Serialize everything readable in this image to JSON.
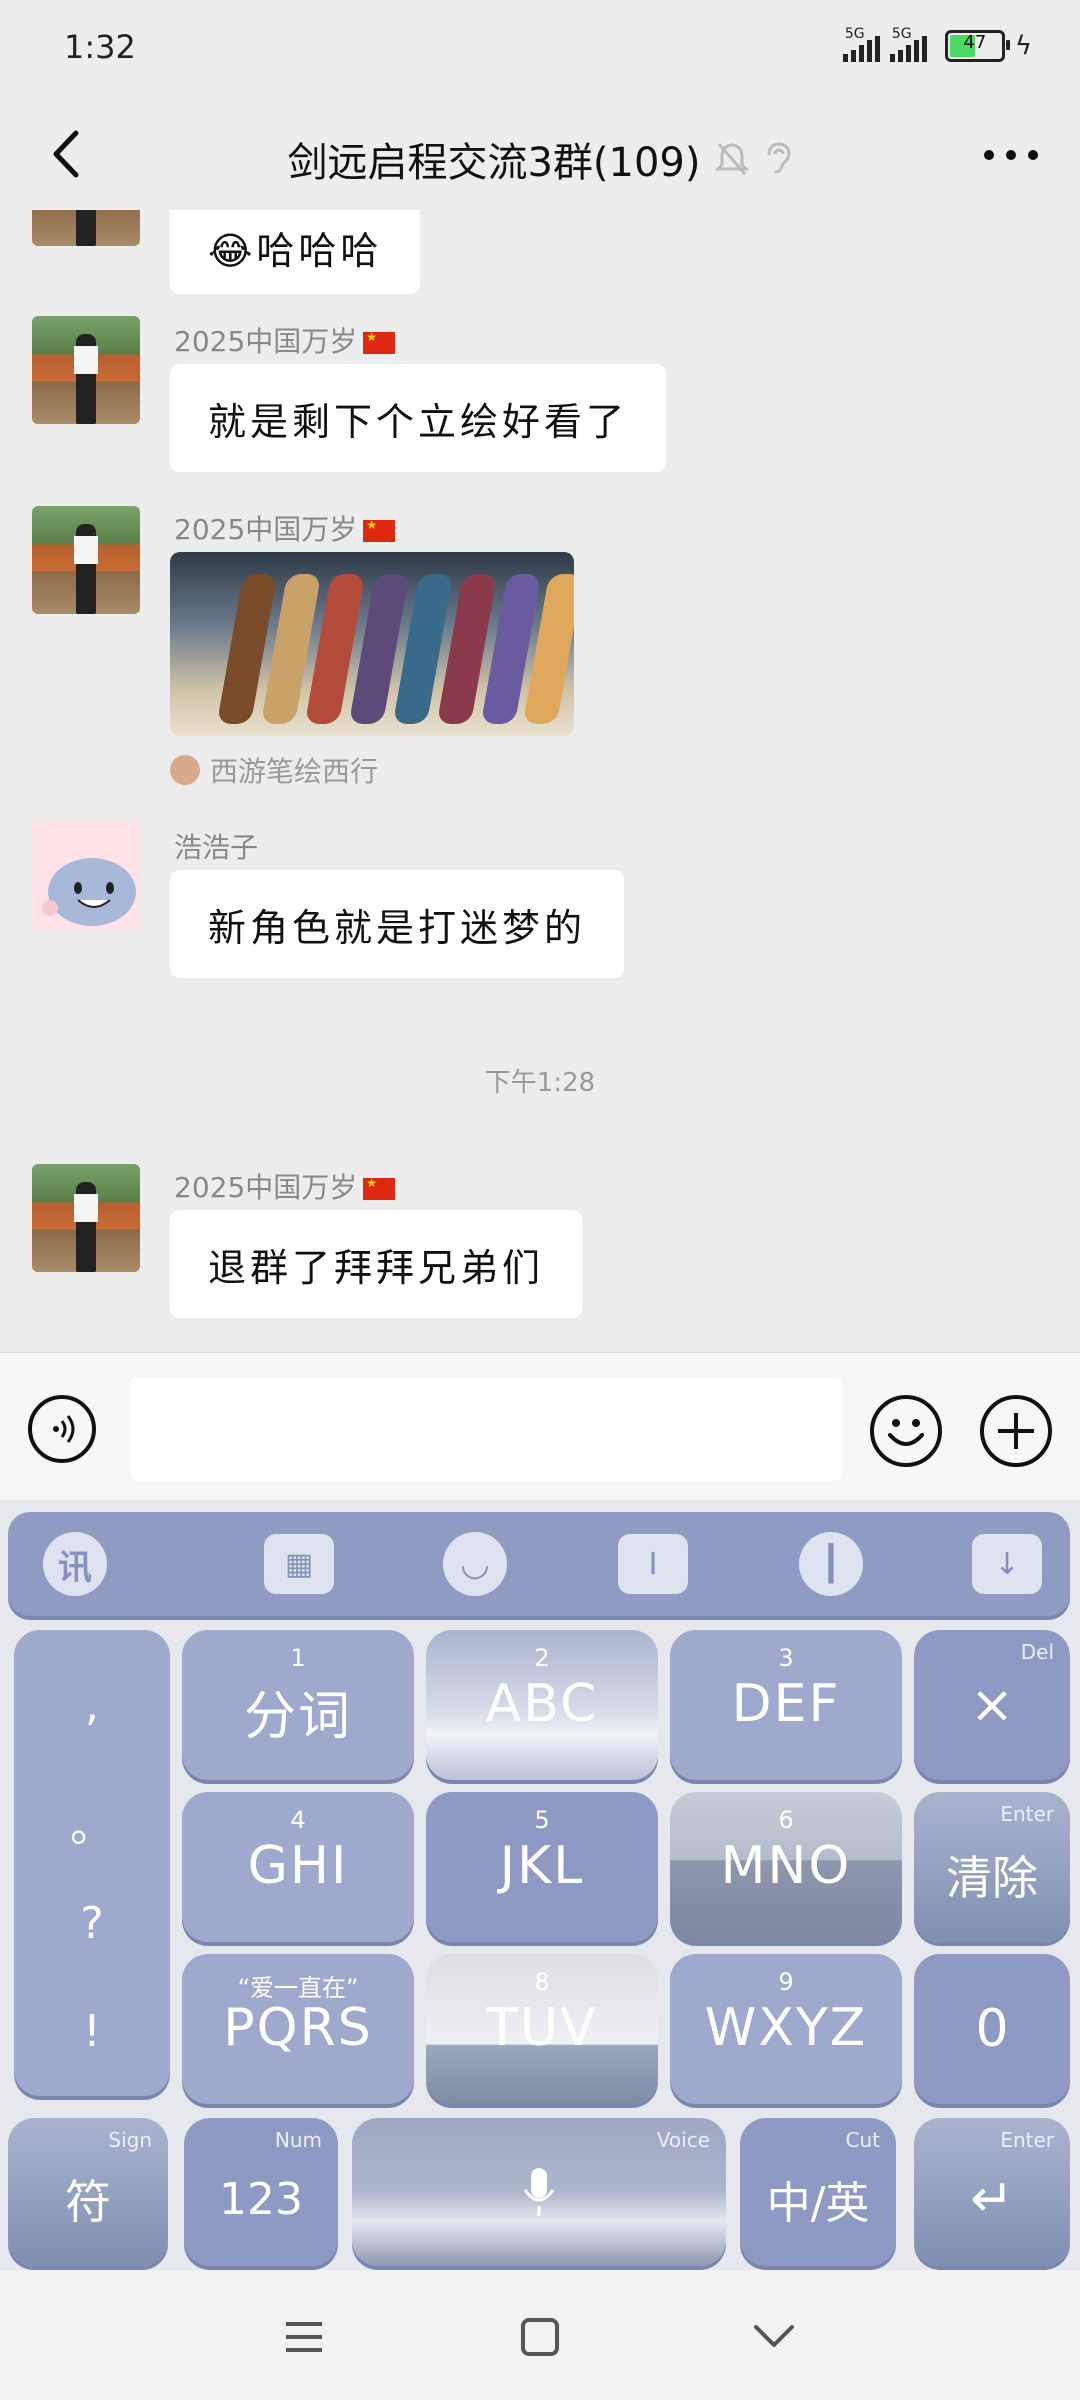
{
  "status_bar": {
    "time": "1:32",
    "sim1": "5G",
    "sim2": "5G",
    "battery": "47"
  },
  "header": {
    "title": "剑远启程交流3群(109)"
  },
  "messages": {
    "m0": {
      "text": "😂哈哈哈"
    },
    "m1": {
      "sender": "2025中国万岁",
      "text": "就是剩下个立绘好看了"
    },
    "m2": {
      "sender": "2025中国万岁",
      "source": "西游笔绘西行"
    },
    "m3": {
      "sender": "浩浩子",
      "text": "新角色就是打迷梦的"
    },
    "timestamp": "下午1:28",
    "m4": {
      "sender": "2025中国万岁",
      "text": "退群了拜拜兄弟们"
    }
  },
  "input": {
    "value": "",
    "placeholder": ""
  },
  "keyboard": {
    "punct": [
      ",",
      "。",
      "?",
      "!"
    ],
    "keys": {
      "k1": {
        "num": "1",
        "label": "分词"
      },
      "k2": {
        "num": "2",
        "label": "ABC"
      },
      "k3": {
        "num": "3",
        "label": "DEF"
      },
      "del": {
        "corner": "Del",
        "label": "×"
      },
      "k4": {
        "num": "4",
        "label": "GHI"
      },
      "k5": {
        "num": "5",
        "label": "JKL"
      },
      "k6": {
        "num": "6",
        "label": "MNO"
      },
      "clear": {
        "corner": "Enter",
        "label": "清除"
      },
      "k7": {
        "num": "“爱一直在”",
        "label": "PQRS"
      },
      "k8": {
        "num": "8",
        "label": "TUV"
      },
      "k9": {
        "num": "9",
        "label": "WXYZ"
      },
      "k0": {
        "label": "0"
      },
      "sym": {
        "corner": "Sign",
        "label": "符"
      },
      "num123": {
        "corner": "Num",
        "label": "123"
      },
      "space": {
        "corner": "Voice"
      },
      "lang": {
        "corner": "Cut",
        "label": "中/英"
      },
      "enter": {
        "corner": "Enter",
        "label": "↵"
      }
    }
  },
  "icons": {
    "back": "chevron-left-icon",
    "mute": "bell-off-icon",
    "ear": "ear-icon",
    "more": "more-dots-icon",
    "voice": "voice-icon",
    "emoji": "emoji-icon",
    "plus": "plus-icon"
  },
  "colors": {
    "background": "#ededed",
    "bubble": "#ffffff",
    "keyboard_key": "#8e9ac3",
    "toolbar": "#8f9bc2"
  }
}
